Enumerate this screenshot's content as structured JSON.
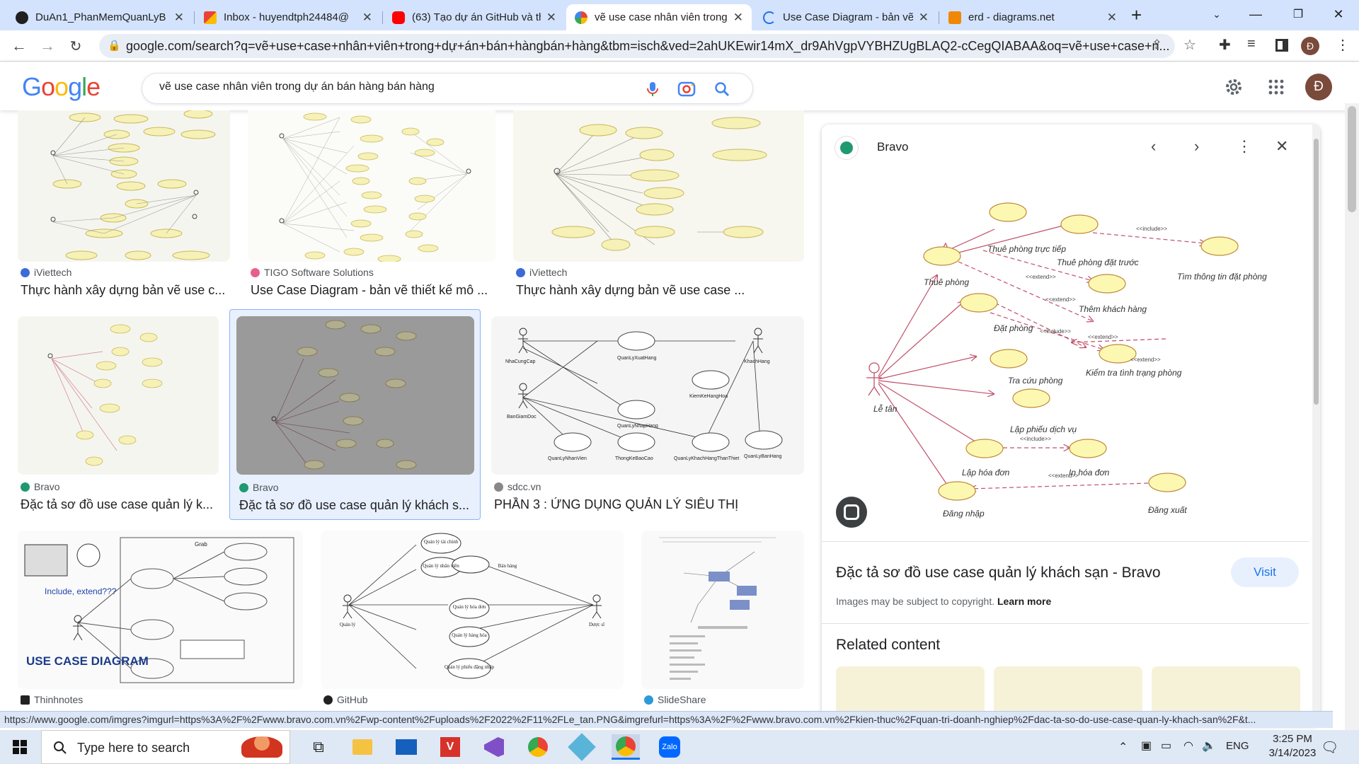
{
  "browser": {
    "tabs": [
      {
        "title": "DuAn1_PhanMemQuanLyB",
        "icon": "github-icon",
        "color": "#1f1f1f"
      },
      {
        "title": "Inbox - huyendtph24484@",
        "icon": "gmail-icon",
        "color": "#ea4335"
      },
      {
        "title": "(63) Tạo dự án GitHub và th",
        "icon": "youtube-icon",
        "color": "#ff0000"
      },
      {
        "title": "vẽ use case nhân viên trong",
        "icon": "google-icon",
        "color": "#4285f4"
      },
      {
        "title": "Use Case Diagram - bản vẽ",
        "icon": "loading-icon",
        "color": "#1a73e8"
      },
      {
        "title": "erd - diagrams.net",
        "icon": "drawio-icon",
        "color": "#f08705"
      }
    ],
    "url": "google.com/search?q=vẽ+use+case+nhân+viên+trong+dự+án+bán+hàngbán+hàng&tbm=isch&ved=2ahUKEwir14mX_dr9AhVgpVYBHZUgBLAQ2-cCegQIABAA&oq=vẽ+use+case+n...",
    "profile_initial": "Đ"
  },
  "google": {
    "logo": "Google",
    "query": "vẽ use case nhân viên trong dự án bán hàng bán hàng",
    "avatar_initial": "Đ"
  },
  "results": [
    {
      "source": "iViettech",
      "title": "Thực hành xây dựng bản vẽ use c..."
    },
    {
      "source": "TIGO Software Solutions",
      "title": "Use Case Diagram - bản vẽ thiết kế mô ..."
    },
    {
      "source": "iViettech",
      "title": "Thực hành xây dựng bản vẽ use case ..."
    },
    {
      "source": "Bravo",
      "title": "Đặc tả sơ đồ use case quản lý k..."
    },
    {
      "source": "Bravo",
      "title": "Đặc tả sơ đồ use case quản lý khách s..."
    },
    {
      "source": "sdcc.vn",
      "title": "PHẦN 3 : ỨNG DỤNG QUẢN LÝ SIÊU THỊ"
    },
    {
      "source": "Thinhnotes",
      "title": ""
    },
    {
      "source": "GitHub",
      "title": ""
    },
    {
      "source": "SlideShare",
      "title": ""
    }
  ],
  "thumb_text": {
    "sdcc": {
      "actor1": "NhaCungCap",
      "actor2": "KhachHang",
      "actor3": "BanGiamDoc",
      "uc1": "QuanLyXuatHang",
      "uc2": "KiemKeHangHoa",
      "uc3": "QuanLyNhapHang",
      "uc4": "QuanLyNhanVien",
      "uc5": "ThongKeBaoCao",
      "uc6": "QuanLyKhachHangThanThiet",
      "uc7": "QuanLyBanHang"
    },
    "thinhnotes": {
      "caption": "Include, extend???",
      "big": "USE CASE DIAGRAM",
      "grab": "Grab"
    },
    "github": {
      "uc1": "Quản lý tài chính",
      "uc2": "Quản lý nhân viên",
      "uc3": "Quản lý hóa đơn",
      "uc4": "Quản lý hàng hóa",
      "uc5": "Quản lý phiếu đặng nhập",
      "uc6": "Bán hàng",
      "actor1": "Quản lý",
      "actor2": "Dược sĩ"
    }
  },
  "panel": {
    "source": "Bravo",
    "title": "Đặc tả sơ đồ use case quản lý khách sạn - Bravo",
    "visit": "Visit",
    "copyright": "Images may be subject to copyright.",
    "learn_more": "Learn more",
    "related": "Related content",
    "diagram": {
      "actor": "Lễ tân",
      "uc_thue_truc_tiep": "Thuê phòng trực tiếp",
      "uc_thue_dat_truoc": "Thuê phòng đặt trước",
      "uc_tim_thong_tin": "Tìm thông tin đặt phòng",
      "uc_thue_phong": "Thuê phòng",
      "uc_them_khach": "Thêm khách hàng",
      "uc_dat_phong": "Đặt phòng",
      "uc_kiem_tra": "Kiểm tra tình trạng phòng",
      "uc_tra_cuu": "Tra cứu phòng",
      "uc_lap_phieu": "Lập phiếu dịch vụ",
      "uc_lap_hoa_don": "Lập hóa đơn",
      "uc_in_hoa_don": "In hóa đơn",
      "uc_dang_nhap": "Đăng nhập",
      "uc_dang_xuat": "Đăng xuất",
      "include": "<<include>>",
      "extend": "<<extend>>"
    }
  },
  "status_url": "https://www.google.com/imgres?imgurl=https%3A%2F%2Fwww.bravo.com.vn%2Fwp-content%2Fuploads%2F2022%2F11%2FLe_tan.PNG&imgrefurl=https%3A%2F%2Fwww.bravo.com.vn%2Fkien-thuc%2Fquan-tri-doanh-nghiep%2Fdac-ta-so-do-use-case-quan-ly-khach-san%2F&t...",
  "taskbar": {
    "search_placeholder": "Type here to search",
    "language": "ENG",
    "time": "3:25 PM",
    "date": "3/14/2023"
  },
  "colors": {
    "tabbar": "#d3e3fd",
    "accent": "#1a73e8",
    "selected_border": "#8ab4f8"
  }
}
